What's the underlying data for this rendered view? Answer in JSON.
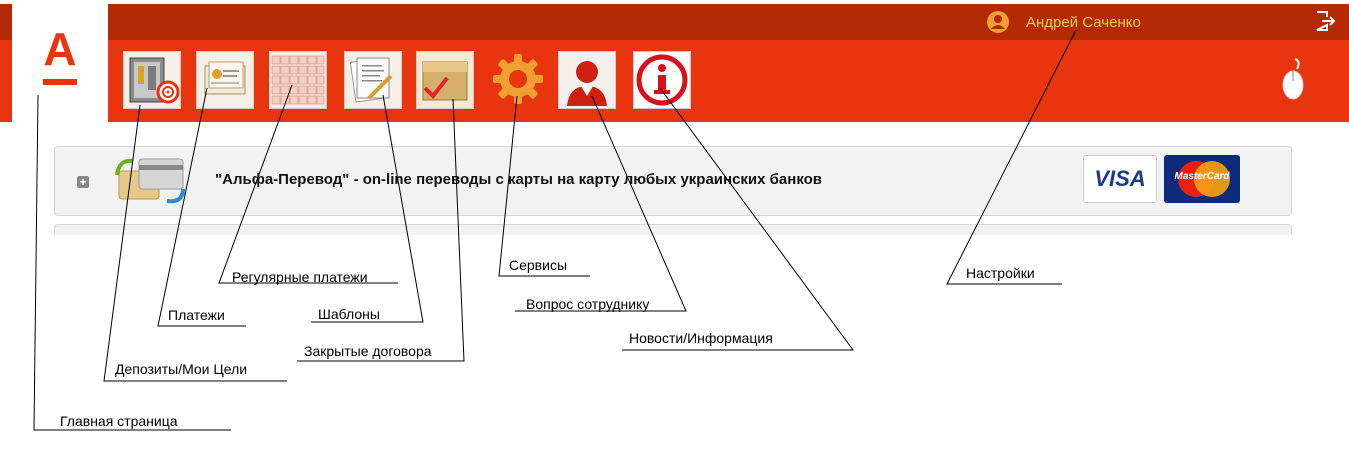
{
  "header": {
    "logo_letter": "А",
    "user_name": "Андрей Саченко",
    "icons": [
      "home-logo",
      "deposits-goals-icon",
      "payments-icon",
      "regular-payments-icon",
      "templates-icon",
      "closed-contracts-icon",
      "services-gear-icon",
      "ask-employee-icon",
      "news-info-icon",
      "user-avatar-icon",
      "exit-icon",
      "mouse-icon"
    ]
  },
  "banner": {
    "title": "\"Альфа-Перевод\" - on-line переводы с карты на карту любых украинских банков",
    "visa_label": "VISA",
    "mastercard_label": "MasterCard"
  },
  "annotations": {
    "home": "Главная страница",
    "deposits": "Депозиты/Мои Цели",
    "payments": "Платежи",
    "regular": "Регулярные платежи",
    "templates": "Шаблоны",
    "closed": "Закрытые договора",
    "services": "Сервисы",
    "ask": "Вопрос сотруднику",
    "news": "Новости/Информация",
    "settings": "Настройки"
  },
  "colors": {
    "brand_red": "#e8340f",
    "dark_red": "#b42a06",
    "username_yellow": "#f7cf3f"
  }
}
